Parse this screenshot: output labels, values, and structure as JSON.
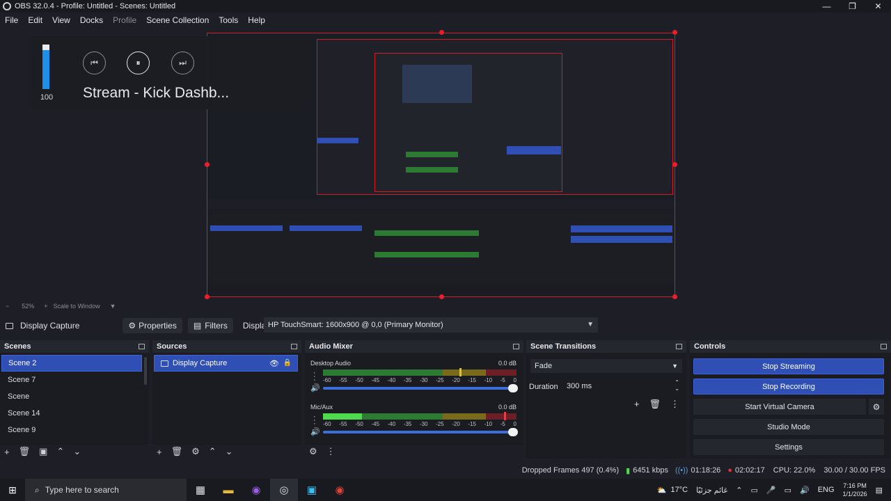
{
  "window": {
    "title": "OBS 32.0.4 - Profile: Untitled - Scenes: Untitled",
    "minimize": "—",
    "maximize": "❐",
    "close": "✕"
  },
  "menu": {
    "file": "File",
    "edit": "Edit",
    "view": "View",
    "docks": "Docks",
    "profile": "Profile",
    "scene_collection": "Scene Collection",
    "tools": "Tools",
    "help": "Help"
  },
  "overlay": {
    "volume": "100",
    "volume_fraction": 0.875,
    "stream_title": "Stream - Kick Dashb...",
    "prev_icon": "⏮",
    "pause_icon": "⏸",
    "next_icon": "⏭"
  },
  "zoom": {
    "minus": "−",
    "value": "52%",
    "plus": "+",
    "mode": "Scale to Window"
  },
  "source_bar": {
    "source_name": "Display Capture",
    "properties": "Properties",
    "filters": "Filters",
    "display_label": "Display",
    "display_value": "HP TouchSmart: 1600x900 @ 0,0 (Primary Monitor)"
  },
  "scenes": {
    "title": "Scenes",
    "items": [
      "Scene 2",
      "Scene 7",
      "Scene",
      "Scene 14",
      "Scene 9"
    ],
    "selected": 0
  },
  "sources": {
    "title": "Sources",
    "items": [
      "Display Capture"
    ]
  },
  "audio_mixer": {
    "title": "Audio Mixer",
    "channels": [
      {
        "name": "Desktop Audio",
        "db": "0.0 dB",
        "level": 0.0
      },
      {
        "name": "Mic/Aux",
        "db": "0.0 dB",
        "level": 0.22
      }
    ],
    "ticks": [
      "-60",
      "-55",
      "-50",
      "-45",
      "-40",
      "-35",
      "-30",
      "-25",
      "-20",
      "-15",
      "-10",
      "-5",
      "0"
    ]
  },
  "scene_transitions": {
    "title": "Scene Transitions",
    "transition": "Fade",
    "duration_label": "Duration",
    "duration_value": "300 ms"
  },
  "controls": {
    "title": "Controls",
    "stop_streaming": "Stop Streaming",
    "stop_recording": "Stop Recording",
    "start_virtual_camera": "Start Virtual Camera",
    "studio_mode": "Studio Mode",
    "settings": "Settings"
  },
  "status": {
    "dropped_frames": "Dropped Frames 497 (0.4%)",
    "bitrate": "6451 kbps",
    "stream_time": "01:18:26",
    "rec_time": "02:02:17",
    "cpu": "CPU: 22.0%",
    "fps": "30.00 / 30.00 FPS"
  },
  "taskbar": {
    "search_placeholder": "Type here to search",
    "weather": "17°C",
    "weather_text": "غائم جزئيًا",
    "language": "ENG",
    "time": "7:16 PM",
    "date": "1/1/2026"
  },
  "colors": {
    "accent": "#2f4fb4",
    "selection_border": "#d01f2a",
    "meter_green": "#4ddb4d"
  }
}
